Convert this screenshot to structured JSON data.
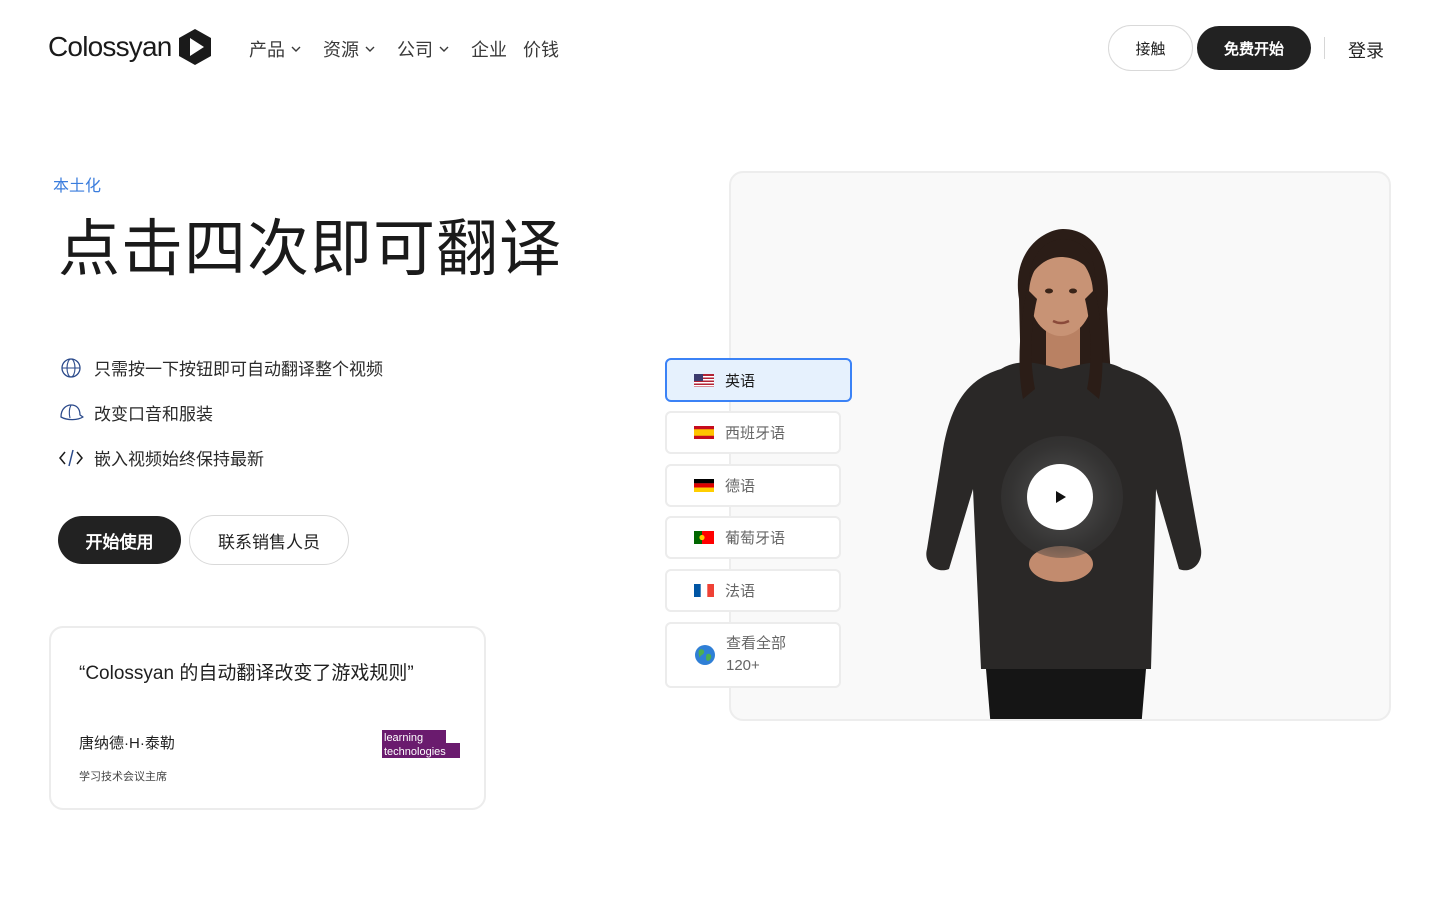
{
  "header": {
    "logo_text": "Colossyan",
    "nav": [
      {
        "label": "产品",
        "has_dropdown": true
      },
      {
        "label": "资源",
        "has_dropdown": true
      },
      {
        "label": "公司",
        "has_dropdown": true
      },
      {
        "label": "企业",
        "has_dropdown": false
      },
      {
        "label": "价钱",
        "has_dropdown": false
      }
    ],
    "contact_label": "接触",
    "free_start_label": "免费开始",
    "login_label": "登录"
  },
  "hero": {
    "eyebrow": "本土化",
    "headline": "点击四次即可翻译",
    "features": [
      {
        "icon": "globe-icon",
        "text": "只需按一下按钮即可自动翻译整个视频"
      },
      {
        "icon": "cap-icon",
        "text": "改变口音和服装"
      },
      {
        "icon": "code-icon",
        "text": "嵌入视频始终保持最新"
      }
    ],
    "primary_cta": "开始使用",
    "secondary_cta": "联系销售人员"
  },
  "testimonial": {
    "quote": "“Colossyan 的自动翻译改变了游戏规则”",
    "author": "唐纳德·H·泰勒",
    "role": "学习技术会议主席",
    "logo_line1": "learning",
    "logo_line2": "technologies"
  },
  "languages": {
    "items": [
      {
        "label": "英语",
        "flag": "us-flag-icon",
        "active": true
      },
      {
        "label": "西班牙语",
        "flag": "spain-flag-icon",
        "active": false
      },
      {
        "label": "德语",
        "flag": "germany-flag-icon",
        "active": false
      },
      {
        "label": "葡萄牙语",
        "flag": "portugal-flag-icon",
        "active": false
      },
      {
        "label": "法语",
        "flag": "france-flag-icon",
        "active": false
      }
    ],
    "more_label": "查看全部",
    "more_count": "120+"
  },
  "colors": {
    "accent_blue": "#3b82f6",
    "dark_button": "#222222",
    "eyebrow_blue": "#3b7ddd",
    "lt_purple": "#6a1b6e"
  }
}
